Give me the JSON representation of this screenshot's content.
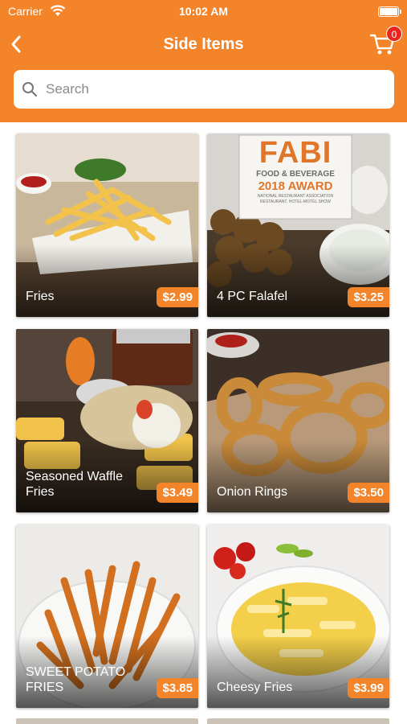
{
  "status_bar": {
    "carrier": "Carrier",
    "time": "10:02 AM"
  },
  "nav": {
    "title": "Side Items",
    "cart_count": "0"
  },
  "search": {
    "placeholder": "Search"
  },
  "items": [
    {
      "name": "Fries",
      "price": "$2.99"
    },
    {
      "name": "4 PC Falafel",
      "price": "$3.25"
    },
    {
      "name": "Seasoned Waffle Fries",
      "price": "$3.49"
    },
    {
      "name": "Onion Rings",
      "price": "$3.50"
    },
    {
      "name": "SWEET POTATO FRIES",
      "price": "$3.85"
    },
    {
      "name": "Cheesy Fries",
      "price": "$3.99"
    }
  ],
  "promo": {
    "brand": "FABI",
    "line1": "FOOD & BEVERAGE",
    "line2": "2018 AWARD",
    "line3": "NATIONAL RESTAURANT ASSOCIATION",
    "line4": "RESTAURANT, HOTEL-MOTEL SHOW"
  },
  "colors": {
    "accent": "#f4842a",
    "badge": "#e8261e"
  }
}
